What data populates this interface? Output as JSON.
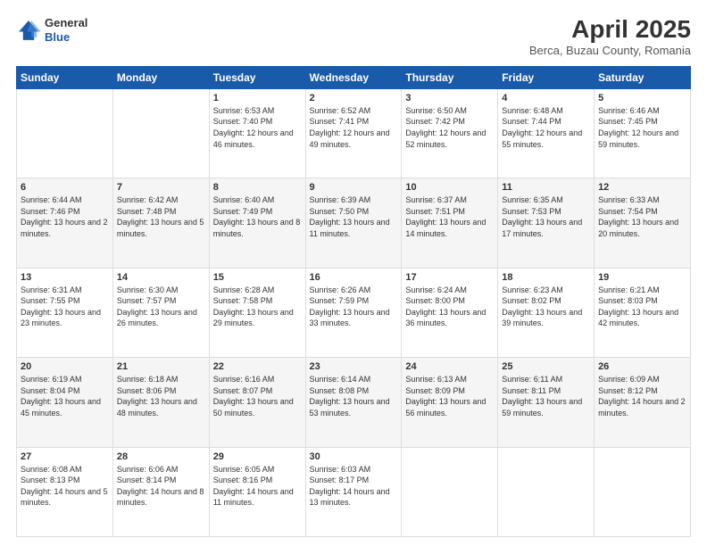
{
  "header": {
    "logo_general": "General",
    "logo_blue": "Blue",
    "month_title": "April 2025",
    "location": "Berca, Buzau County, Romania"
  },
  "weekdays": [
    "Sunday",
    "Monday",
    "Tuesday",
    "Wednesday",
    "Thursday",
    "Friday",
    "Saturday"
  ],
  "weeks": [
    [
      {
        "day": "",
        "sunrise": "",
        "sunset": "",
        "daylight": ""
      },
      {
        "day": "",
        "sunrise": "",
        "sunset": "",
        "daylight": ""
      },
      {
        "day": "1",
        "sunrise": "Sunrise: 6:53 AM",
        "sunset": "Sunset: 7:40 PM",
        "daylight": "Daylight: 12 hours and 46 minutes."
      },
      {
        "day": "2",
        "sunrise": "Sunrise: 6:52 AM",
        "sunset": "Sunset: 7:41 PM",
        "daylight": "Daylight: 12 hours and 49 minutes."
      },
      {
        "day": "3",
        "sunrise": "Sunrise: 6:50 AM",
        "sunset": "Sunset: 7:42 PM",
        "daylight": "Daylight: 12 hours and 52 minutes."
      },
      {
        "day": "4",
        "sunrise": "Sunrise: 6:48 AM",
        "sunset": "Sunset: 7:44 PM",
        "daylight": "Daylight: 12 hours and 55 minutes."
      },
      {
        "day": "5",
        "sunrise": "Sunrise: 6:46 AM",
        "sunset": "Sunset: 7:45 PM",
        "daylight": "Daylight: 12 hours and 59 minutes."
      }
    ],
    [
      {
        "day": "6",
        "sunrise": "Sunrise: 6:44 AM",
        "sunset": "Sunset: 7:46 PM",
        "daylight": "Daylight: 13 hours and 2 minutes."
      },
      {
        "day": "7",
        "sunrise": "Sunrise: 6:42 AM",
        "sunset": "Sunset: 7:48 PM",
        "daylight": "Daylight: 13 hours and 5 minutes."
      },
      {
        "day": "8",
        "sunrise": "Sunrise: 6:40 AM",
        "sunset": "Sunset: 7:49 PM",
        "daylight": "Daylight: 13 hours and 8 minutes."
      },
      {
        "day": "9",
        "sunrise": "Sunrise: 6:39 AM",
        "sunset": "Sunset: 7:50 PM",
        "daylight": "Daylight: 13 hours and 11 minutes."
      },
      {
        "day": "10",
        "sunrise": "Sunrise: 6:37 AM",
        "sunset": "Sunset: 7:51 PM",
        "daylight": "Daylight: 13 hours and 14 minutes."
      },
      {
        "day": "11",
        "sunrise": "Sunrise: 6:35 AM",
        "sunset": "Sunset: 7:53 PM",
        "daylight": "Daylight: 13 hours and 17 minutes."
      },
      {
        "day": "12",
        "sunrise": "Sunrise: 6:33 AM",
        "sunset": "Sunset: 7:54 PM",
        "daylight": "Daylight: 13 hours and 20 minutes."
      }
    ],
    [
      {
        "day": "13",
        "sunrise": "Sunrise: 6:31 AM",
        "sunset": "Sunset: 7:55 PM",
        "daylight": "Daylight: 13 hours and 23 minutes."
      },
      {
        "day": "14",
        "sunrise": "Sunrise: 6:30 AM",
        "sunset": "Sunset: 7:57 PM",
        "daylight": "Daylight: 13 hours and 26 minutes."
      },
      {
        "day": "15",
        "sunrise": "Sunrise: 6:28 AM",
        "sunset": "Sunset: 7:58 PM",
        "daylight": "Daylight: 13 hours and 29 minutes."
      },
      {
        "day": "16",
        "sunrise": "Sunrise: 6:26 AM",
        "sunset": "Sunset: 7:59 PM",
        "daylight": "Daylight: 13 hours and 33 minutes."
      },
      {
        "day": "17",
        "sunrise": "Sunrise: 6:24 AM",
        "sunset": "Sunset: 8:00 PM",
        "daylight": "Daylight: 13 hours and 36 minutes."
      },
      {
        "day": "18",
        "sunrise": "Sunrise: 6:23 AM",
        "sunset": "Sunset: 8:02 PM",
        "daylight": "Daylight: 13 hours and 39 minutes."
      },
      {
        "day": "19",
        "sunrise": "Sunrise: 6:21 AM",
        "sunset": "Sunset: 8:03 PM",
        "daylight": "Daylight: 13 hours and 42 minutes."
      }
    ],
    [
      {
        "day": "20",
        "sunrise": "Sunrise: 6:19 AM",
        "sunset": "Sunset: 8:04 PM",
        "daylight": "Daylight: 13 hours and 45 minutes."
      },
      {
        "day": "21",
        "sunrise": "Sunrise: 6:18 AM",
        "sunset": "Sunset: 8:06 PM",
        "daylight": "Daylight: 13 hours and 48 minutes."
      },
      {
        "day": "22",
        "sunrise": "Sunrise: 6:16 AM",
        "sunset": "Sunset: 8:07 PM",
        "daylight": "Daylight: 13 hours and 50 minutes."
      },
      {
        "day": "23",
        "sunrise": "Sunrise: 6:14 AM",
        "sunset": "Sunset: 8:08 PM",
        "daylight": "Daylight: 13 hours and 53 minutes."
      },
      {
        "day": "24",
        "sunrise": "Sunrise: 6:13 AM",
        "sunset": "Sunset: 8:09 PM",
        "daylight": "Daylight: 13 hours and 56 minutes."
      },
      {
        "day": "25",
        "sunrise": "Sunrise: 6:11 AM",
        "sunset": "Sunset: 8:11 PM",
        "daylight": "Daylight: 13 hours and 59 minutes."
      },
      {
        "day": "26",
        "sunrise": "Sunrise: 6:09 AM",
        "sunset": "Sunset: 8:12 PM",
        "daylight": "Daylight: 14 hours and 2 minutes."
      }
    ],
    [
      {
        "day": "27",
        "sunrise": "Sunrise: 6:08 AM",
        "sunset": "Sunset: 8:13 PM",
        "daylight": "Daylight: 14 hours and 5 minutes."
      },
      {
        "day": "28",
        "sunrise": "Sunrise: 6:06 AM",
        "sunset": "Sunset: 8:14 PM",
        "daylight": "Daylight: 14 hours and 8 minutes."
      },
      {
        "day": "29",
        "sunrise": "Sunrise: 6:05 AM",
        "sunset": "Sunset: 8:16 PM",
        "daylight": "Daylight: 14 hours and 11 minutes."
      },
      {
        "day": "30",
        "sunrise": "Sunrise: 6:03 AM",
        "sunset": "Sunset: 8:17 PM",
        "daylight": "Daylight: 14 hours and 13 minutes."
      },
      {
        "day": "",
        "sunrise": "",
        "sunset": "",
        "daylight": ""
      },
      {
        "day": "",
        "sunrise": "",
        "sunset": "",
        "daylight": ""
      },
      {
        "day": "",
        "sunrise": "",
        "sunset": "",
        "daylight": ""
      }
    ]
  ]
}
